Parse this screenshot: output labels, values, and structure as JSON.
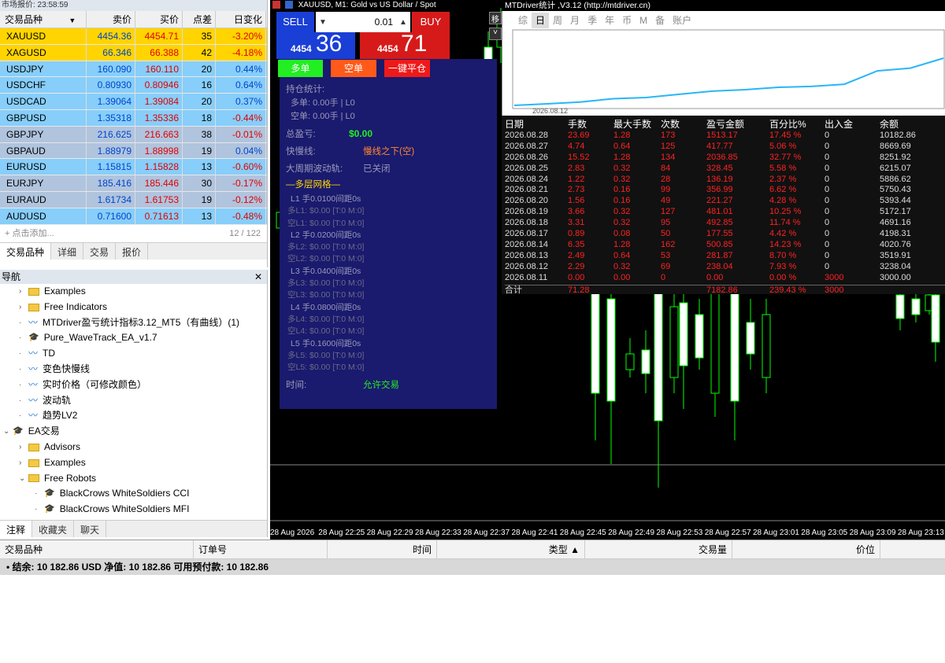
{
  "market_watch": {
    "title": "市场报价: 23:58:59",
    "headers": [
      "交易品种",
      "卖价",
      "买价",
      "点差",
      "日变化"
    ],
    "rows": [
      {
        "symbol": "XAUUSD",
        "bid": "4454.36",
        "ask": "4454.71",
        "spread": "35",
        "change": "-3.20%",
        "bg": "#ffd400",
        "dir": "neg"
      },
      {
        "symbol": "XAGUSD",
        "bid": "66.346",
        "ask": "66.388",
        "spread": "42",
        "change": "-4.18%",
        "bg": "#ffd400",
        "dir": "neg"
      },
      {
        "symbol": "USDJPY",
        "bid": "160.090",
        "ask": "160.110",
        "spread": "20",
        "change": "0.44%",
        "bg": "#87cefa",
        "dir": "pos"
      },
      {
        "symbol": "USDCHF",
        "bid": "0.80930",
        "ask": "0.80946",
        "spread": "16",
        "change": "0.64%",
        "bg": "#87cefa",
        "dir": "pos"
      },
      {
        "symbol": "USDCAD",
        "bid": "1.39064",
        "ask": "1.39084",
        "spread": "20",
        "change": "0.37%",
        "bg": "#87cefa",
        "dir": "pos"
      },
      {
        "symbol": "GBPUSD",
        "bid": "1.35318",
        "ask": "1.35336",
        "spread": "18",
        "change": "-0.44%",
        "bg": "#87cefa",
        "dir": "neg"
      },
      {
        "symbol": "GBPJPY",
        "bid": "216.625",
        "ask": "216.663",
        "spread": "38",
        "change": "-0.01%",
        "bg": "#b0c4de",
        "dir": "neg"
      },
      {
        "symbol": "GBPAUD",
        "bid": "1.88979",
        "ask": "1.88998",
        "spread": "19",
        "change": "0.04%",
        "bg": "#b0c4de",
        "dir": "pos"
      },
      {
        "symbol": "EURUSD",
        "bid": "1.15815",
        "ask": "1.15828",
        "spread": "13",
        "change": "-0.60%",
        "bg": "#87cefa",
        "dir": "neg"
      },
      {
        "symbol": "EURJPY",
        "bid": "185.416",
        "ask": "185.446",
        "spread": "30",
        "change": "-0.17%",
        "bg": "#b0c4de",
        "dir": "neg"
      },
      {
        "symbol": "EURAUD",
        "bid": "1.61734",
        "ask": "1.61753",
        "spread": "19",
        "change": "-0.12%",
        "bg": "#b0c4de",
        "dir": "neg"
      },
      {
        "symbol": "AUDUSD",
        "bid": "0.71600",
        "ask": "0.71613",
        "spread": "13",
        "change": "-0.48%",
        "bg": "#87cefa",
        "dir": "neg"
      }
    ],
    "add_label": "点击添加...",
    "count": "12 / 122",
    "tabs": [
      "交易品种",
      "详细",
      "交易",
      "报价"
    ]
  },
  "navigator": {
    "title": "导航",
    "items": [
      {
        "indent": 1,
        "arrow": "›",
        "type": "folder",
        "label": "Examples"
      },
      {
        "indent": 1,
        "arrow": "›",
        "type": "folder",
        "label": "Free Indicators"
      },
      {
        "indent": 1,
        "arrow": "",
        "type": "ind",
        "label": "MTDriver盈亏统计指标3.12_MT5（有曲线）(1)"
      },
      {
        "indent": 1,
        "arrow": "",
        "type": "cap",
        "label": "Pure_WaveTrack_EA_v1.7"
      },
      {
        "indent": 1,
        "arrow": "",
        "type": "ind",
        "label": "TD"
      },
      {
        "indent": 1,
        "arrow": "",
        "type": "ind",
        "label": "变色快慢线"
      },
      {
        "indent": 1,
        "arrow": "",
        "type": "ind",
        "label": "实时价格（可修改颜色）"
      },
      {
        "indent": 1,
        "arrow": "",
        "type": "ind",
        "label": "波动轨"
      },
      {
        "indent": 1,
        "arrow": "",
        "type": "ind",
        "label": "趋势LV2"
      },
      {
        "indent": 0,
        "arrow": "⌄",
        "type": "cap",
        "label": "EA交易"
      },
      {
        "indent": 1,
        "arrow": "›",
        "type": "folder",
        "label": "Advisors"
      },
      {
        "indent": 1,
        "arrow": "›",
        "type": "folder",
        "label": "Examples"
      },
      {
        "indent": 1,
        "arrow": "⌄",
        "type": "folder",
        "label": "Free Robots"
      },
      {
        "indent": 2,
        "arrow": "",
        "type": "cap",
        "label": "BlackCrows WhiteSoldiers CCI"
      },
      {
        "indent": 2,
        "arrow": "",
        "type": "cap",
        "label": "BlackCrows WhiteSoldiers MFI"
      }
    ],
    "tabs": [
      "注释",
      "收藏夹",
      "聊天"
    ]
  },
  "chart": {
    "symbol_title": "XAUUSD, M1:  Gold vs US Dollar / Spot",
    "sell_label": "SELL",
    "buy_label": "BUY",
    "lot": "0.01",
    "sell_price_small": "4454",
    "sell_price_big": "36",
    "buy_price_small": "4454",
    "buy_price_big": "71",
    "btn_long": "多单",
    "btn_short": "空单",
    "btn_close": "一键平仓",
    "panel": {
      "pos_title": "持仓统计:",
      "long_pos": "多单: 0.00手 | L0",
      "short_pos": "空单: 0.00手 | L0",
      "pnl_label": "总盈亏:",
      "pnl_value": "$0.00",
      "ma_label": "快慢线:",
      "ma_value": "慢线之下(空)",
      "band_label": "大周期波动轨:",
      "band_value": "已关闭",
      "grid_title": "—多层网格—",
      "grid_lines": [
        "L1 手0.0100间距0s",
        "多L1: $0.00 [T:0 M:0]",
        "空L1: $0.00 [T:0 M:0]",
        "L2 手0.0200间距0s",
        "多L2: $0.00 [T:0 M:0]",
        "空L2: $0.00 [T:0 M:0]",
        "L3 手0.0400间距0s",
        "多L3: $0.00 [T:0 M:0]",
        "空L3: $0.00 [T:0 M:0]",
        "L4 手0.0800间距0s",
        "多L4: $0.00 [T:0 M:0]",
        "空L4: $0.00 [T:0 M:0]",
        "L5 手0.1600间距0s",
        "多L5: $0.00 [T:0 M:0]",
        "空L5: $0.00 [T:0 M:0]"
      ],
      "time_label": "时间:",
      "time_value": "允许交易"
    },
    "x_labels": [
      "28 Aug 2026",
      "28 Aug 22:25",
      "28 Aug 22:29",
      "28 Aug 22:33",
      "28 Aug 22:37",
      "28 Aug 22:41",
      "28 Aug 22:45",
      "28 Aug 22:49",
      "28 Aug 22:53",
      "28 Aug 22:57",
      "28 Aug 23:01",
      "28 Aug 23:05",
      "28 Aug 23:09",
      "28 Aug 23:13"
    ]
  },
  "stats": {
    "title": "MTDriver统计 ,V3.12 (http://mtdriver.cn)",
    "tabs": [
      "综",
      "日",
      "周",
      "月",
      "季",
      "年",
      "币",
      "M",
      "备",
      "账户"
    ],
    "curve_label": "2026.08.12",
    "headers": [
      "日期",
      "手数",
      "最大手数",
      "次数",
      "盈亏金额",
      "百分比%",
      "出入金",
      "余额"
    ],
    "rows": [
      [
        "2026.08.28",
        "23.69",
        "1.28",
        "173",
        "1513.17",
        "17.45 %",
        "0",
        "10182.86"
      ],
      [
        "2026.08.27",
        "4.74",
        "0.64",
        "125",
        "417.77",
        "5.06 %",
        "0",
        "8669.69"
      ],
      [
        "2026.08.26",
        "15.52",
        "1.28",
        "134",
        "2036.85",
        "32.77 %",
        "0",
        "8251.92"
      ],
      [
        "2026.08.25",
        "2.83",
        "0.32",
        "84",
        "328.45",
        "5.58 %",
        "0",
        "6215.07"
      ],
      [
        "2026.08.24",
        "1.22",
        "0.32",
        "28",
        "136.19",
        "2.37 %",
        "0",
        "5886.62"
      ],
      [
        "2026.08.21",
        "2.73",
        "0.16",
        "99",
        "356.99",
        "6.62 %",
        "0",
        "5750.43"
      ],
      [
        "2026.08.20",
        "1.56",
        "0.16",
        "49",
        "221.27",
        "4.28 %",
        "0",
        "5393.44"
      ],
      [
        "2026.08.19",
        "3.66",
        "0.32",
        "127",
        "481.01",
        "10.25 %",
        "0",
        "5172.17"
      ],
      [
        "2026.08.18",
        "3.31",
        "0.32",
        "95",
        "492.85",
        "11.74 %",
        "0",
        "4691.16"
      ],
      [
        "2026.08.17",
        "0.89",
        "0.08",
        "50",
        "177.55",
        "4.42 %",
        "0",
        "4198.31"
      ],
      [
        "2026.08.14",
        "6.35",
        "1.28",
        "162",
        "500.85",
        "14.23 %",
        "0",
        "4020.76"
      ],
      [
        "2026.08.13",
        "2.49",
        "0.64",
        "53",
        "281.87",
        "8.70 %",
        "0",
        "3519.91"
      ],
      [
        "2026.08.12",
        "2.29",
        "0.32",
        "69",
        "238.04",
        "7.93 %",
        "0",
        "3238.04"
      ],
      [
        "2026.08.11",
        "0.00",
        "0.00",
        "0",
        "0.00",
        "0.00 %",
        "3000",
        "3000.00"
      ]
    ],
    "total": [
      "合计",
      "71.28",
      "",
      "",
      "7182.86",
      "239.43 %",
      "3000",
      ""
    ],
    "curve_points": [
      0,
      238.04,
      519.91,
      1020.76,
      1198.31,
      1691.16,
      2172.17,
      2393.44,
      2750.43,
      2886.62,
      3215.07,
      5251.92,
      5669.69,
      7182.86
    ]
  },
  "toolbox": {
    "headers": [
      "交易品种",
      "订单号",
      "时间",
      "类型 ▲",
      "交易量",
      "价位"
    ],
    "balance": "结余: 10 182.86 USD  净值: 10 182.86  可用预付款: 10 182.86"
  },
  "colors": {
    "bull": "#00ff00",
    "panel_bg": "#1a1a6e",
    "sell_bg": "#1a3fd6",
    "buy_bg": "#d61a1a",
    "curve": "#29b6f6",
    "loss": "#ff2222"
  }
}
